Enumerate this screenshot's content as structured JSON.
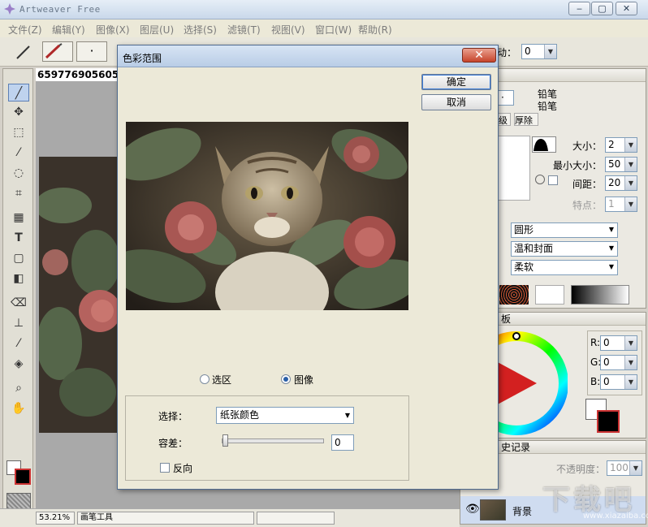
{
  "window": {
    "title": "Artweaver Free",
    "minimize_glyph": "‒",
    "maximize_glyph": "▢",
    "close_glyph": "✕"
  },
  "menu": [
    {
      "label": "文件(Z)"
    },
    {
      "label": "编辑(Y)"
    },
    {
      "label": "图像(X)"
    },
    {
      "label": "图层(U)"
    },
    {
      "label": "选择(S)"
    },
    {
      "label": "滤镜(T)"
    },
    {
      "label": "视图(V)"
    },
    {
      "label": "窗口(W)"
    },
    {
      "label": "帮助(R)"
    }
  ],
  "options_bar": {
    "flow_label": "动：",
    "flow_value": "0"
  },
  "document": {
    "tab_title": "65977690560522"
  },
  "status": {
    "zoom": "53.21%",
    "tool_name": "画笔工具"
  },
  "brush_panel": {
    "tool_name_1": "铅笔",
    "tool_name_2": "铅笔",
    "tab_label": "级",
    "tab_thickness": "厚除",
    "size_label": "大小：",
    "size_value": "2",
    "min_size_label": "最小大小：",
    "min_size_value": "50",
    "spacing_label": "间距：",
    "spacing_value": "20",
    "feature_label": "特点：",
    "feature_value": "1",
    "shape_value": "圆形",
    "paper_value": "温和封面",
    "softness_value": "柔软"
  },
  "color_panel": {
    "title": "板",
    "r_label": "R:",
    "r_value": "0",
    "g_label": "G:",
    "g_value": "0",
    "b_label": "B:",
    "b_value": "0"
  },
  "history_panel": {
    "title": "史记录",
    "opacity_label": "不透明度：",
    "opacity_value": "100",
    "layer_name": "背景"
  },
  "dialog": {
    "title": "色彩范围",
    "ok_label": "确定",
    "cancel_label": "取消",
    "radio_selection": "选区",
    "radio_image": "图像",
    "select_label": "选择：",
    "select_value": "纸张颜色",
    "tolerance_label": "容差：",
    "tolerance_value": "0",
    "invert_label": "反向",
    "close_glyph": "✕"
  },
  "watermark": {
    "text": "下载吧",
    "url": "www.xiazaiba.com"
  },
  "colors": {
    "title_gradient_top": "#e6eef7",
    "dialog_bg": "#ece9d8",
    "close_red": "#c7442b",
    "active_tool": "#bfd3ee"
  }
}
